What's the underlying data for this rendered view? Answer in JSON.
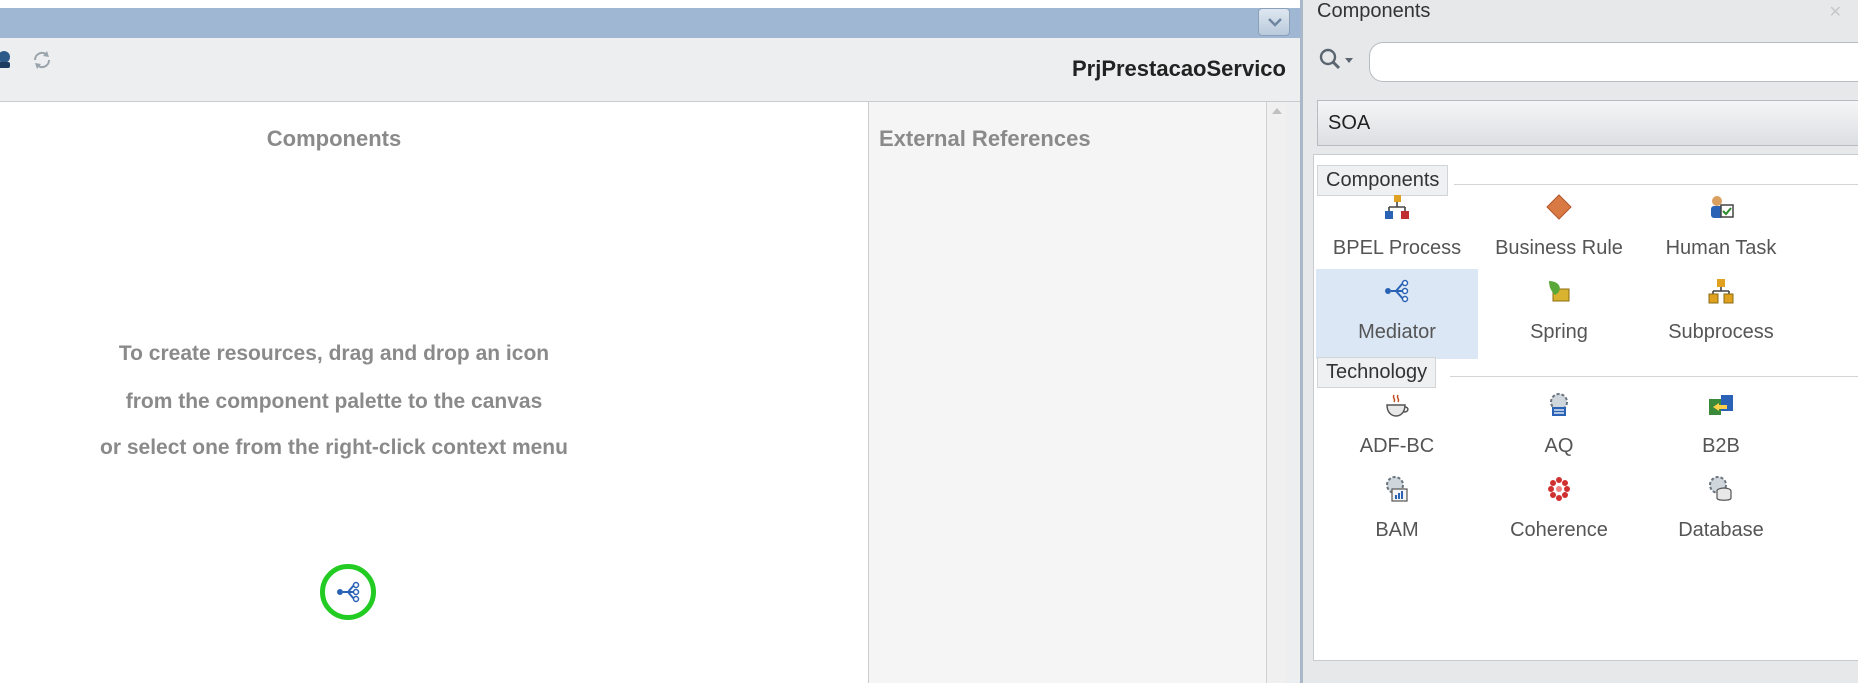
{
  "editor": {
    "project_title": "PrjPrestacaoServico",
    "components_heading": "Components",
    "external_references_heading": "External References",
    "hint_lines": [
      "To create resources, drag and drop an icon",
      "from the component palette to the canvas",
      "or select one from the right-click context menu"
    ],
    "highlighted_icon": "mediator-icon",
    "highlight_color": "#22cc22"
  },
  "palette": {
    "title": "Components",
    "search_placeholder": "",
    "category": "SOA",
    "groups": [
      {
        "label": "Components",
        "items": [
          {
            "label": "BPEL Process",
            "icon": "bpel-process-icon"
          },
          {
            "label": "Business Rule",
            "icon": "business-rule-icon"
          },
          {
            "label": "Human Task",
            "icon": "human-task-icon"
          },
          {
            "label": "Mediator",
            "icon": "mediator-icon",
            "selected": true
          },
          {
            "label": "Spring",
            "icon": "spring-icon"
          },
          {
            "label": "Subprocess",
            "icon": "subprocess-icon"
          }
        ]
      },
      {
        "label": "Technology",
        "items": [
          {
            "label": "ADF-BC",
            "icon": "adf-bc-icon"
          },
          {
            "label": "AQ",
            "icon": "aq-icon"
          },
          {
            "label": "B2B",
            "icon": "b2b-icon"
          },
          {
            "label": "BAM",
            "icon": "bam-icon"
          },
          {
            "label": "Coherence",
            "icon": "coherence-icon"
          },
          {
            "label": "Database",
            "icon": "database-icon"
          }
        ]
      }
    ]
  },
  "colors": {
    "title_bar": "#9fb7d3",
    "toolbar": "#eceeef",
    "selected_item": "#dbe7f5",
    "muted_text": "#8a8a8a"
  }
}
